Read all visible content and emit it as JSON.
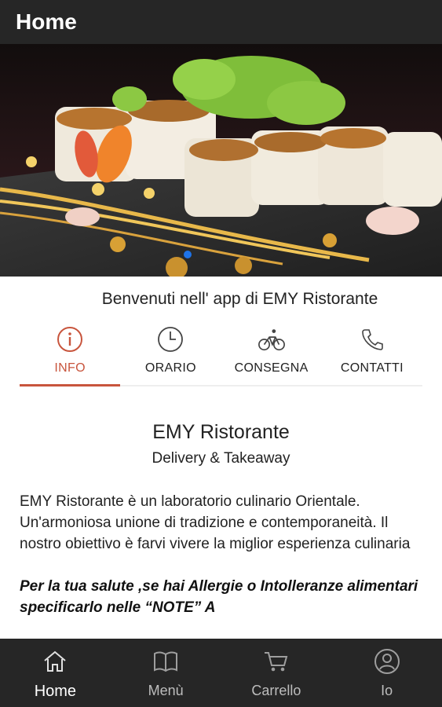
{
  "appbar": {
    "title": "Home"
  },
  "hero": {
    "image_alt": "sushi-rolls-photo"
  },
  "welcome": "Benvenuti nell' app di EMY Ristorante",
  "tabs": [
    {
      "label": "INFO",
      "icon": "info-icon",
      "active": true
    },
    {
      "label": "ORARIO",
      "icon": "clock-icon",
      "active": false
    },
    {
      "label": "CONSEGNA",
      "icon": "bicycle-icon",
      "active": false
    },
    {
      "label": "CONTATTI",
      "icon": "phone-icon",
      "active": false
    }
  ],
  "info": {
    "title": "EMY Ristorante",
    "subtitle": "Delivery & Takeaway",
    "description": "EMY Ristorante è un laboratorio culinario Orientale. Un'armoniosa unione di tradizione e contemporaneità. Il nostro obiettivo è farvi vivere la miglior esperienza culinaria",
    "note": "Per la tua salute ,se hai Allergie o Intolleranze alimentari specificarlo nelle “NOTE” A"
  },
  "bottom_nav": [
    {
      "label": "Home",
      "icon": "home-icon",
      "active": true
    },
    {
      "label": "Menù",
      "icon": "book-icon",
      "active": false
    },
    {
      "label": "Carrello",
      "icon": "cart-icon",
      "active": false
    },
    {
      "label": "Io",
      "icon": "user-icon",
      "active": false
    }
  ],
  "colors": {
    "bar": "#262626",
    "accent": "#c8553d",
    "pager": "#1e73e8"
  }
}
